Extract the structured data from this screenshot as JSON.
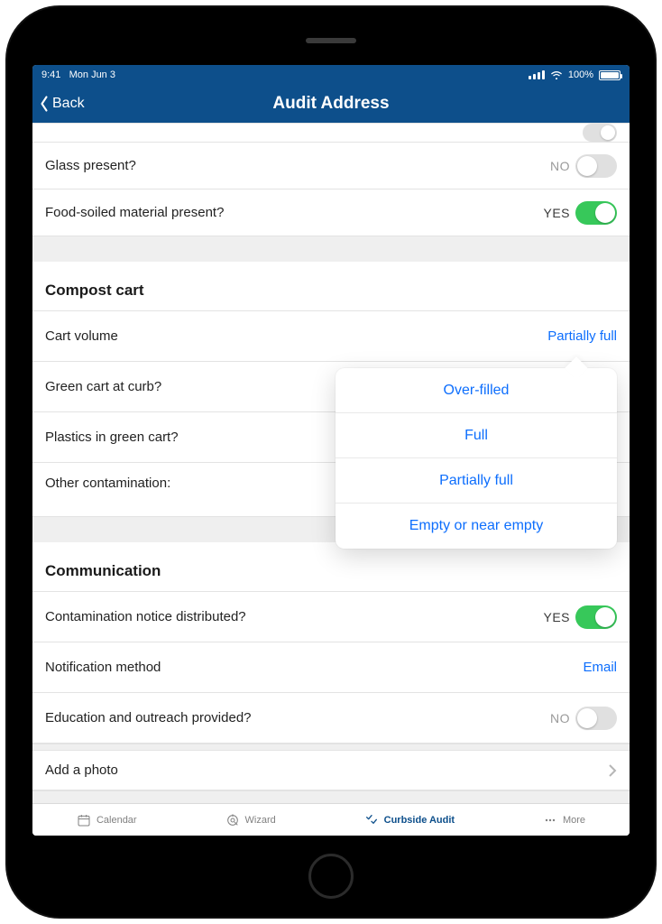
{
  "status": {
    "time": "9:41",
    "date": "Mon Jun 3",
    "battery_pct": "100%"
  },
  "nav": {
    "back_label": "Back",
    "title": "Audit Address"
  },
  "rows": {
    "glass_present_label": "Glass present?",
    "glass_present_value": "NO",
    "food_soiled_label": "Food-soiled material present?",
    "food_soiled_value": "YES"
  },
  "compost": {
    "header": "Compost cart",
    "cart_volume_label": "Cart volume",
    "cart_volume_value": "Partially full",
    "green_cart_label": "Green cart at curb?",
    "plastics_label": "Plastics in green cart?",
    "other_contam_label": "Other contamination:"
  },
  "cart_volume_options": [
    "Over-filled",
    "Full",
    "Partially full",
    "Empty or near empty"
  ],
  "communication": {
    "header": "Communication",
    "contam_notice_label": "Contamination notice distributed?",
    "contam_notice_value": "YES",
    "notification_method_label": "Notification method",
    "notification_method_value": "Email",
    "education_label": "Education and outreach provided?",
    "education_value": "NO"
  },
  "add_photo_label": "Add a photo",
  "tabs": {
    "calendar": "Calendar",
    "wizard": "Wizard",
    "curbside": "Curbside Audit",
    "more": "More"
  }
}
